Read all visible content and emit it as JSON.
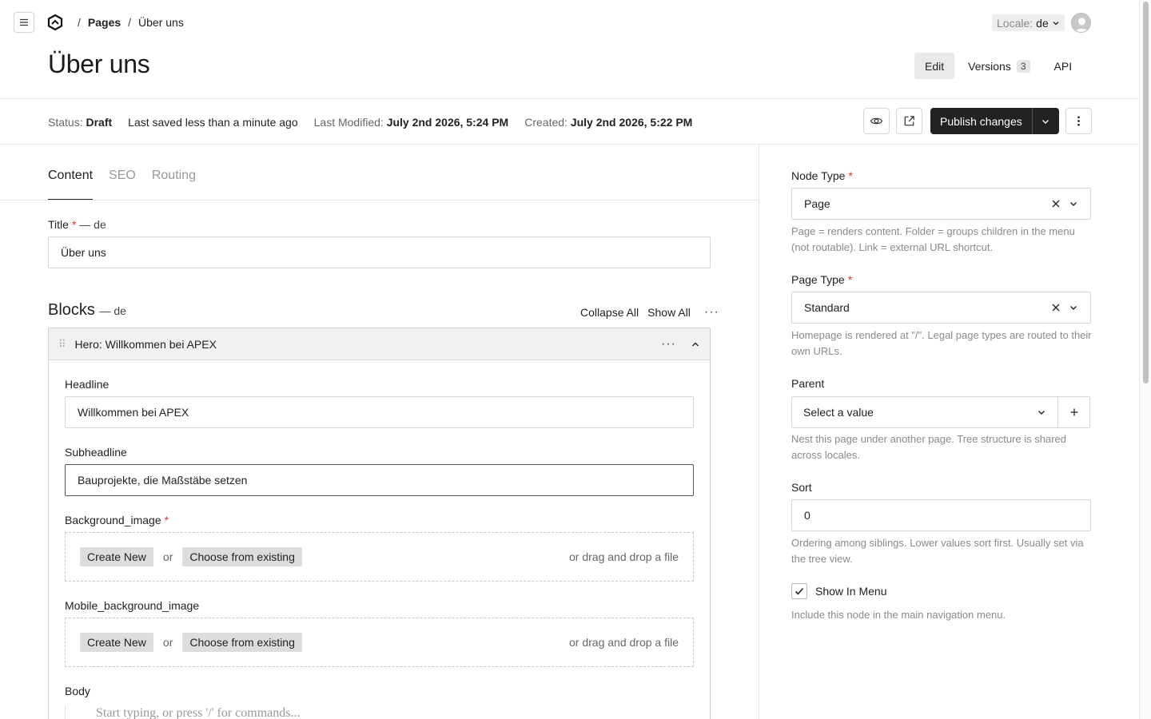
{
  "topbar": {
    "breadcrumb": [
      "Pages",
      "Über uns"
    ],
    "locale_label": "Locale:",
    "locale_value": "de"
  },
  "header": {
    "title": "Über uns",
    "views": [
      {
        "label": "Edit",
        "active": true
      },
      {
        "label": "Versions",
        "count": "3"
      },
      {
        "label": "API"
      }
    ]
  },
  "status": {
    "status_key": "Status:",
    "status_value": "Draft",
    "saved": "Last saved less than a minute ago",
    "modified_key": "Last Modified:",
    "modified_value": "July 2nd 2026, 5:24 PM",
    "created_key": "Created:",
    "created_value": "July 2nd 2026, 5:22 PM",
    "publish_label": "Publish changes"
  },
  "tabs": [
    "Content",
    "SEO",
    "Routing"
  ],
  "content": {
    "title_label": "Title",
    "title_locale": "— de",
    "title_value": "Über uns",
    "blocks_label": "Blocks",
    "blocks_locale": "— de",
    "collapse_all": "Collapse All",
    "show_all": "Show All",
    "block": {
      "header": "Hero: Willkommen bei APEX",
      "headline_label": "Headline",
      "headline_value": "Willkommen bei APEX",
      "subheadline_label": "Subheadline",
      "subheadline_value": "Bauprojekte, die Maßstäbe setzen",
      "bg_label": "Background_image",
      "mobile_bg_label": "Mobile_background_image",
      "create_new": "Create New",
      "or": "or",
      "choose_existing": "Choose from existing",
      "drag_drop": "or drag and drop a file",
      "body_label": "Body",
      "body_placeholder": "Start typing, or press '/' for commands..."
    }
  },
  "sidebar": {
    "node_type_label": "Node Type",
    "node_type_value": "Page",
    "node_type_help": "Page = renders content. Folder = groups children in the menu (not routable). Link = external URL shortcut.",
    "page_type_label": "Page Type",
    "page_type_value": "Standard",
    "page_type_help": "Homepage is rendered at \"/\". Legal page types are routed to their own URLs.",
    "parent_label": "Parent",
    "parent_placeholder": "Select a value",
    "parent_help": "Nest this page under another page. Tree structure is shared across locales.",
    "sort_label": "Sort",
    "sort_value": "0",
    "sort_help": "Ordering among siblings. Lower values sort first. Usually set via the tree view.",
    "show_in_menu_label": "Show In Menu",
    "show_in_menu_checked": true,
    "show_in_menu_help": "Include this node in the main navigation menu."
  }
}
